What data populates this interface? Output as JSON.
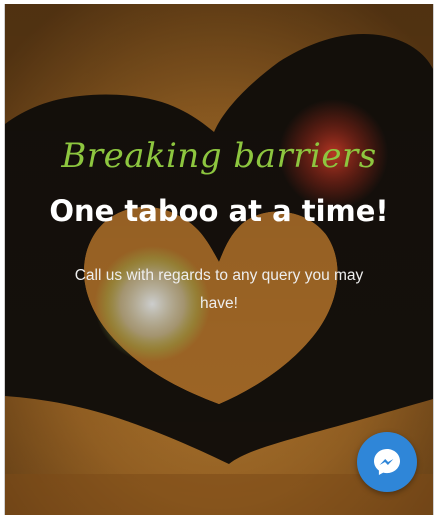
{
  "hero": {
    "headline_script": "Breaking barriers",
    "headline_main": "One taboo at a time!",
    "subtext": "Call us with regards to any query you may have!"
  },
  "chat_widget": {
    "icon": "messenger-icon",
    "color": "#2f86d8"
  },
  "colors": {
    "accent_green": "#8dc63f",
    "headline_white": "#ffffff"
  }
}
